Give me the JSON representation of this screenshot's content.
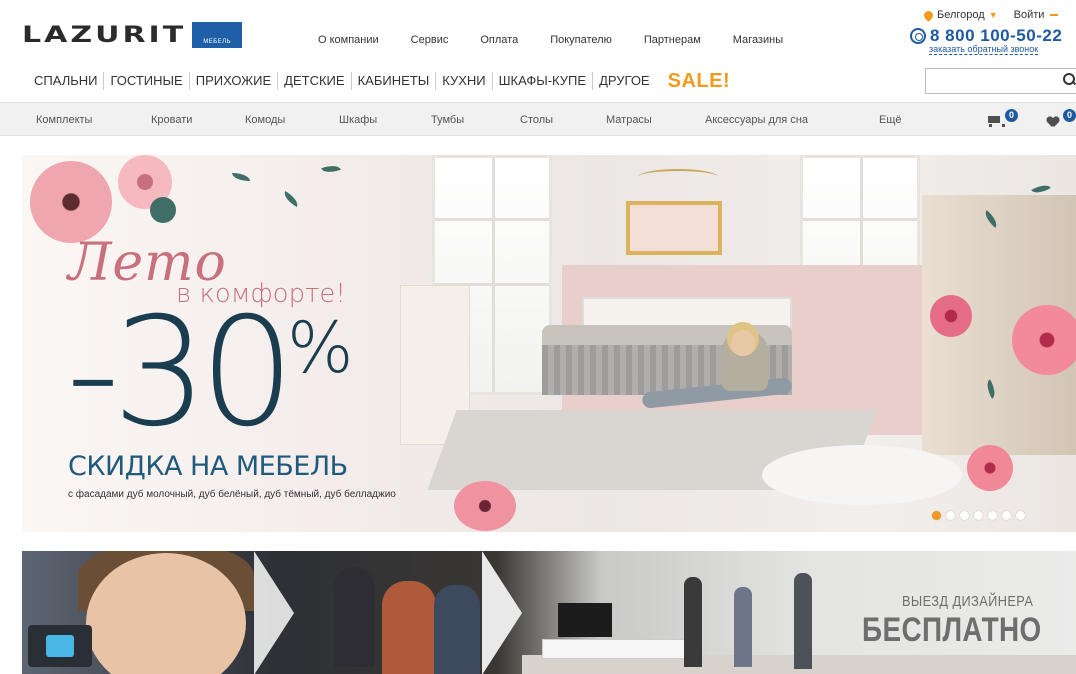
{
  "header": {
    "logo": {
      "text": "LAZURIT",
      "sub": "МЕБЕЛЬ"
    },
    "top_nav": [
      "О компании",
      "Сервис",
      "Оплата",
      "Покупателю",
      "Партнерам",
      "Магазины"
    ],
    "city": "Белгород",
    "login": "Войти",
    "phone": "8 800 100-50-22",
    "callback": "заказать обратный звонок"
  },
  "categories": [
    "СПАЛЬНИ",
    "ГОСТИНЫЕ",
    "ПРИХОЖИЕ",
    "ДЕТСКИЕ",
    "КАБИНЕТЫ",
    "КУХНИ",
    "ШКАФЫ-КУПЕ",
    "ДРУГОЕ"
  ],
  "sale_label": "SALE!",
  "search": {
    "placeholder": ""
  },
  "subnav": [
    "Комплекты",
    "Кровати",
    "Комоды",
    "Шкафы",
    "Тумбы",
    "Столы",
    "Матрасы",
    "Аксессуары для сна",
    "Ещё"
  ],
  "cart_count": "0",
  "wishlist_count": "0",
  "hero": {
    "title_script": "Лето",
    "title_rest": "в комфорте!",
    "discount": "-30",
    "percent": "%",
    "headline": "СКИДКА НА МЕБЕЛЬ",
    "subtext": "с фасадами дуб молочный, дуб белёный, дуб тёмный, дуб белладжио",
    "slides_total": 7,
    "active_slide": 1
  },
  "banner2": {
    "line1": "ВЫЕЗД ДИЗАЙНЕРА",
    "line2": "БЕСПЛАТНО"
  },
  "colors": {
    "accent_orange": "#f39a1e",
    "brand_blue": "#1e5aa0",
    "hero_pink": "#c9707e",
    "hero_navy": "#1b3d50"
  }
}
